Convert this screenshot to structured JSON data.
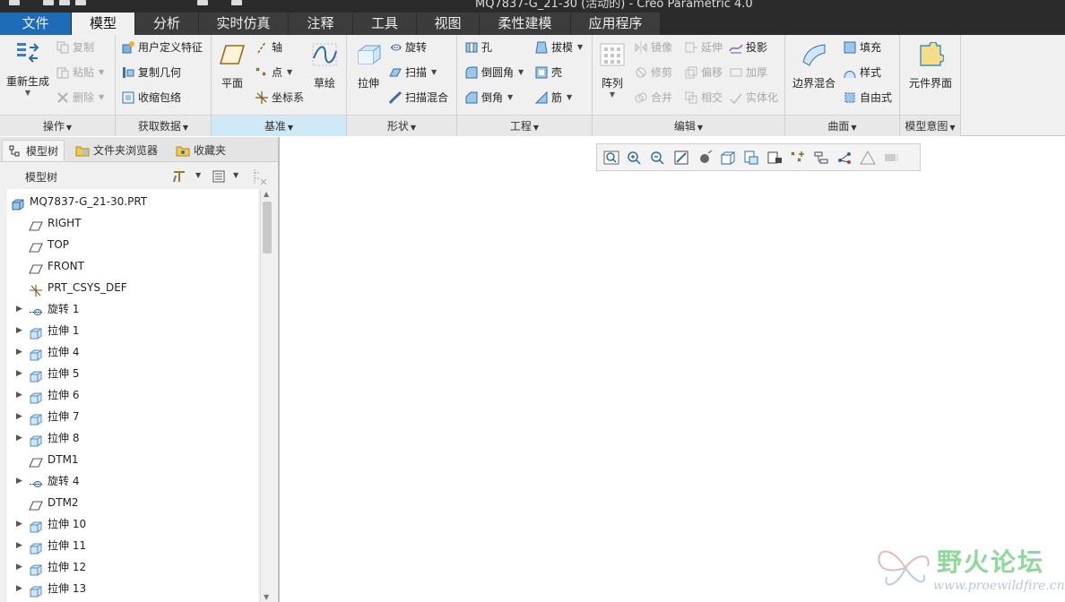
{
  "window": {
    "title": "MQ7837-G_21-30 (活动的) - Creo Parametric 4.0"
  },
  "tabs": [
    {
      "label": "文件",
      "active": false
    },
    {
      "label": "模型",
      "active": true
    },
    {
      "label": "分析",
      "active": false
    },
    {
      "label": "实时仿真",
      "active": false
    },
    {
      "label": "注释",
      "active": false
    },
    {
      "label": "工具",
      "active": false
    },
    {
      "label": "视图",
      "active": false
    },
    {
      "label": "柔性建模",
      "active": false
    },
    {
      "label": "应用程序",
      "active": false
    }
  ],
  "ribbon": {
    "operations": {
      "label": "操作",
      "regenerate": "重新生成",
      "copy": "复制",
      "paste": "粘贴",
      "delete": "删除"
    },
    "get_data": {
      "label": "获取数据",
      "user_feature": "用户定义特征",
      "copy_geom": "复制几何",
      "shrinkwrap": "收缩包络"
    },
    "datum": {
      "label": "基准",
      "plane": "平面",
      "axis": "轴",
      "point": "点",
      "csys": "坐标系",
      "sketch": "草绘"
    },
    "shapes": {
      "label": "形状",
      "extrude": "拉伸",
      "revolve": "旋转",
      "sweep": "扫描",
      "swept_blend": "扫描混合"
    },
    "engineering": {
      "label": "工程",
      "hole": "孔",
      "round": "倒圆角",
      "chamfer": "倒角",
      "draft": "拔模",
      "shell": "壳",
      "rib": "筋"
    },
    "editing": {
      "label": "编辑",
      "pattern": "阵列",
      "mirror": "镜像",
      "extend": "延伸",
      "project": "投影",
      "trim": "修剪",
      "offset": "偏移",
      "thicken": "加厚",
      "merge": "合并",
      "intersect": "相交",
      "solidify": "实体化"
    },
    "surfaces": {
      "label": "曲面",
      "boundary_blend": "边界混合",
      "fill": "填充",
      "style": "样式",
      "freestyle": "自由式"
    },
    "model_intent": {
      "label": "模型意图",
      "component_interface": "元件界面"
    }
  },
  "left_panel": {
    "tabs": [
      {
        "label": "模型树",
        "active": true
      },
      {
        "label": "文件夹浏览器",
        "active": false
      },
      {
        "label": "收藏夹",
        "active": false
      }
    ],
    "header": "模型树",
    "tree": [
      {
        "label": "MQ7837-G_21-30.PRT",
        "type": "part",
        "expandable": false,
        "indent": 0
      },
      {
        "label": "RIGHT",
        "type": "plane",
        "expandable": false,
        "indent": 1
      },
      {
        "label": "TOP",
        "type": "plane",
        "expandable": false,
        "indent": 1
      },
      {
        "label": "FRONT",
        "type": "plane",
        "expandable": false,
        "indent": 1
      },
      {
        "label": "PRT_CSYS_DEF",
        "type": "csys",
        "expandable": false,
        "indent": 1
      },
      {
        "label": "旋转 1",
        "type": "revolve",
        "expandable": true,
        "indent": 1
      },
      {
        "label": "拉伸 1",
        "type": "extrude",
        "expandable": true,
        "indent": 1
      },
      {
        "label": "拉伸 4",
        "type": "extrude",
        "expandable": true,
        "indent": 1
      },
      {
        "label": "拉伸 5",
        "type": "extrude",
        "expandable": true,
        "indent": 1
      },
      {
        "label": "拉伸 6",
        "type": "extrude",
        "expandable": true,
        "indent": 1
      },
      {
        "label": "拉伸 7",
        "type": "extrude",
        "expandable": true,
        "indent": 1
      },
      {
        "label": "拉伸 8",
        "type": "extrude",
        "expandable": true,
        "indent": 1
      },
      {
        "label": "DTM1",
        "type": "plane",
        "expandable": false,
        "indent": 1
      },
      {
        "label": "旋转 4",
        "type": "revolve",
        "expandable": true,
        "indent": 1
      },
      {
        "label": "DTM2",
        "type": "plane",
        "expandable": false,
        "indent": 1
      },
      {
        "label": "拉伸 10",
        "type": "extrude",
        "expandable": true,
        "indent": 1
      },
      {
        "label": "拉伸 11",
        "type": "extrude",
        "expandable": true,
        "indent": 1
      },
      {
        "label": "拉伸 12",
        "type": "extrude",
        "expandable": true,
        "indent": 1
      },
      {
        "label": "拉伸 13",
        "type": "extrude",
        "expandable": true,
        "indent": 1
      }
    ]
  },
  "graphics_toolbar": [
    "refit-icon",
    "zoom-in-icon",
    "zoom-out-icon",
    "repaint-icon",
    "display-style-icon",
    "saved-orientations-icon",
    "view-manager-icon",
    "perspective-icon",
    "datum-display-icon",
    "annotation-display-icon",
    "spin-center-icon",
    "note-display-icon",
    "appearance-icon"
  ],
  "watermark": {
    "title": "野火论坛",
    "url": "www.proewildfire.cn"
  },
  "colors": {
    "accent": "#cfe9f7",
    "titlebar": "#2b2b2b",
    "ribbon": "#f0f0f0",
    "watermark": "#8fd89b"
  }
}
